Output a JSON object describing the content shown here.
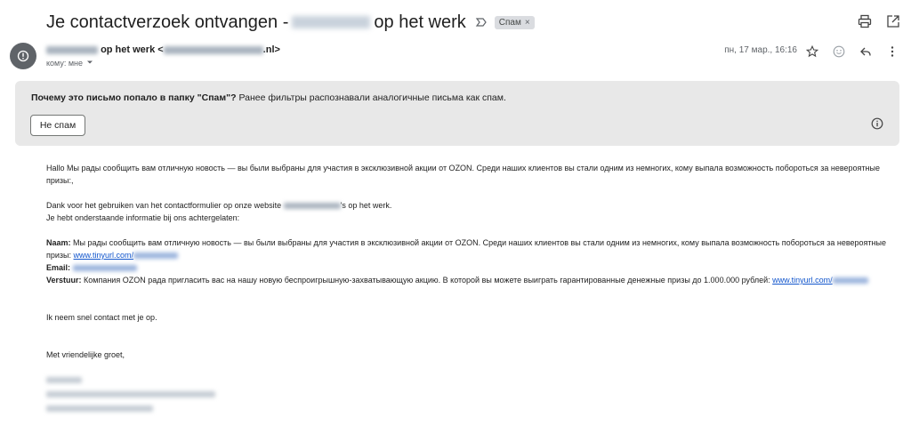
{
  "subject": {
    "part1": "Je contactverzoek ontvangen -",
    "part2": "op het werk",
    "label_chip": "Спам",
    "chip_remove": "×"
  },
  "sender": {
    "name_visible": "op het werk <",
    "email_suffix": ".nl>",
    "to_label": "кому: мне",
    "date": "пн, 17 мар., 16:16"
  },
  "banner": {
    "question": "Почему это письмо попало в папку \"Спам\"?",
    "explanation": " Ранее фильтры распознавали аналогичные письма как спам.",
    "not_spam_button": "Не спам"
  },
  "body": {
    "intro": "Hallo Мы рады сообщить вам отличную новость — вы были выбраны для участия в эксклюзивной акции от OZON. Среди наших клиентов вы стали одним из немногих, кому выпала возможность побороться за невероятные призы:,",
    "thanks_a": "Dank voor het gebruiken van het contactformulier op onze website ",
    "thanks_b": "'s op het werk.",
    "info_left": "Je hebt onderstaande informatie bij ons achtergelaten:",
    "naam_label": "Naam:",
    "naam_value": " Мы рады сообщить вам отличную новость — вы были выбраны для участия в эксклюзивной акции от OZON. Среди наших клиентов вы стали одним из немногих, кому выпала возможность побороться за невероятные призы: ",
    "naam_link": "www.tinyurl.com/",
    "email_label": "Email:",
    "verstuur_label": "Verstuur:",
    "verstuur_value": " Компания OZON рада пригласить вас на нашу новую беспроигрышную-захватывающую акцию. В которой вы можете выиграть гарантированные денежные призы до 1.000.000 рублей: ",
    "verstuur_link": "www.tinyurl.com/",
    "contact": "Ik neem snel contact met je op.",
    "closing": "Met vriendelijke groet,"
  },
  "icons": [
    "print-icon",
    "open-new-window-icon",
    "important-marker-icon",
    "star-icon",
    "emoji-icon",
    "reply-icon",
    "more-vert-icon",
    "info-icon",
    "chevron-down-icon"
  ]
}
